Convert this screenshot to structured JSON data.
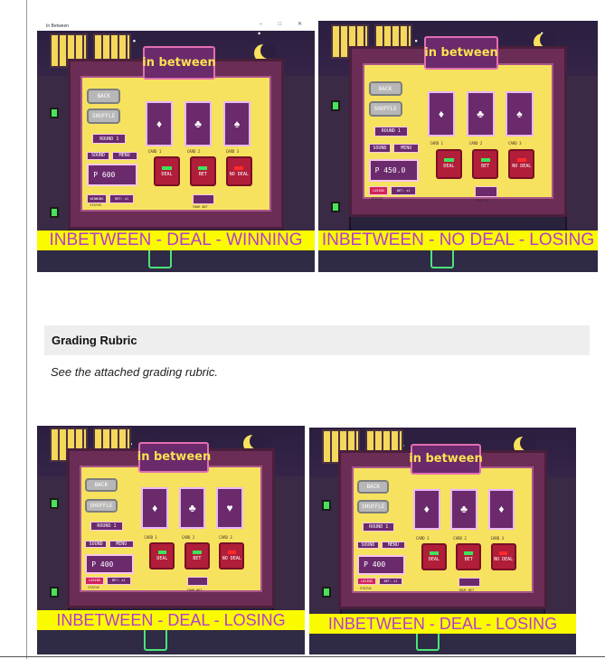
{
  "window_title": "In Between",
  "window_controls": "– □ ✕",
  "rubric": {
    "title": "Grading Rubric",
    "text": "See the attached grading rubric."
  },
  "game_labels": {
    "logo": "in between",
    "back": "BACK",
    "shuffle": "SHUFFLE",
    "round": "ROUND 1",
    "sound": "SOUND",
    "menu": "MENU",
    "card1": "CARD 1",
    "card2": "CARD 2",
    "card3": "CARD 3",
    "deal": "DEAL",
    "bet": "BET",
    "no_deal": "NO DEAL",
    "status": "STATUS",
    "your_bet": "YOUR BET",
    "bet_x": "BET: x1"
  },
  "screens": [
    {
      "caption": "INBETWEEN - DEAL - WINNING",
      "money": "P 600",
      "status": "WINNING",
      "status_color": "#6a2a6c",
      "cards": [
        "♦",
        "♣",
        "♠"
      ]
    },
    {
      "caption": "INBETWEEN - NO DEAL - LOSING",
      "money": "P 450.0",
      "status": "LOSING",
      "status_color": "#d0245a",
      "cards": [
        "♦",
        "♣",
        "♠"
      ]
    },
    {
      "caption": "INBETWEEN - DEAL - LOSING",
      "money": "P 400",
      "status": "LOSING",
      "status_color": "#d0245a",
      "cards": [
        "♦",
        "♣",
        "♥"
      ]
    },
    {
      "caption": "INBETWEEN - DEAL - LOSING",
      "money": "P 400",
      "status": "LOSING",
      "status_color": "#d0245a",
      "cards": [
        "♦",
        "♣",
        "♦"
      ]
    }
  ],
  "colors": {
    "caption_bg": "#fbfb00",
    "caption_text": "#b63ad2",
    "board": "#f6e25f",
    "button_red": "#b01e3a"
  }
}
